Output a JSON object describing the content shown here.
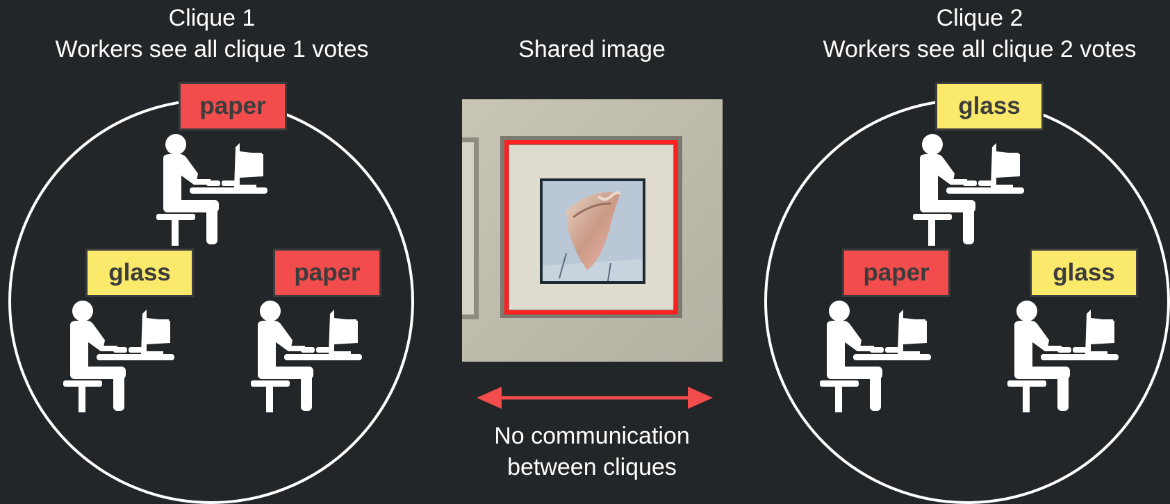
{
  "clique1": {
    "title": "Clique 1",
    "subtitle": "Workers see all clique 1 votes",
    "workers": [
      {
        "vote": "paper",
        "color": "#f24c4c"
      },
      {
        "vote": "glass",
        "color": "#fae96b"
      },
      {
        "vote": "paper",
        "color": "#f24c4c"
      }
    ]
  },
  "clique2": {
    "title": "Clique 2",
    "subtitle": "Workers see all clique 2 votes",
    "workers": [
      {
        "vote": "glass",
        "color": "#fae96b"
      },
      {
        "vote": "paper",
        "color": "#f24c4c"
      },
      {
        "vote": "glass",
        "color": "#fae96b"
      }
    ]
  },
  "center": {
    "image_caption": "Shared image",
    "arrow_caption_line1": "No communication",
    "arrow_caption_line2": "between cliques",
    "arrow_color": "#f24c4c"
  },
  "colors": {
    "background": "#222628",
    "paper_tag": "#f24c4c",
    "glass_tag": "#fae96b"
  }
}
